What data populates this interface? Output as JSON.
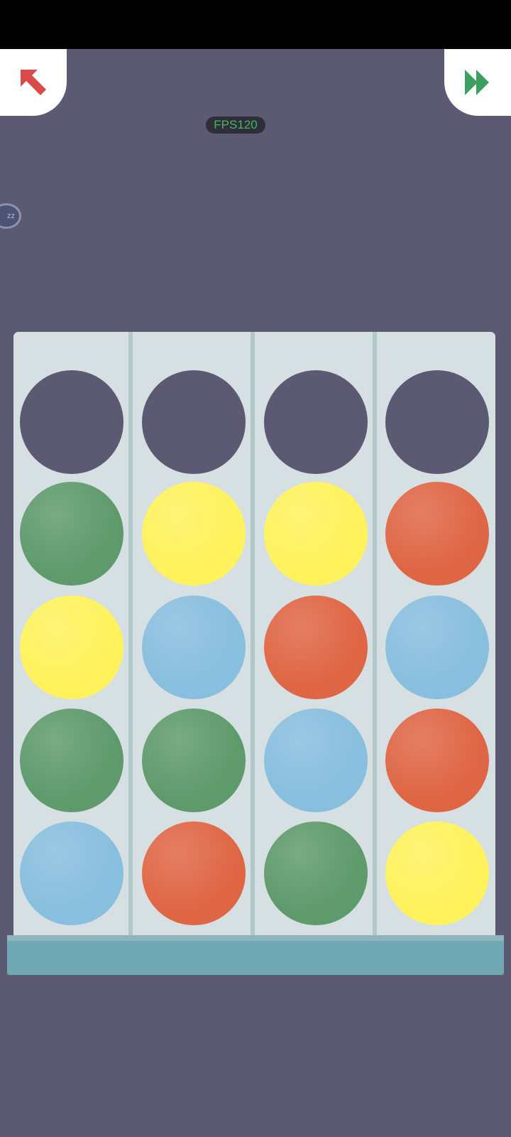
{
  "header": {
    "back_icon": "arrow-up-left-icon",
    "skip_icon": "fast-forward-icon",
    "fps_label": "FPS120",
    "bubble_label": "zz"
  },
  "colors": {
    "empty": "#5c5a72",
    "green": "#5f9a6c",
    "yellow": "#fff25c",
    "red": "#df6645",
    "blue": "#88bede",
    "back_arrow": "#d94a4a",
    "skip_arrow": "#3c9f5f"
  },
  "board": {
    "tubes": [
      [
        "empty",
        "green",
        "yellow",
        "green",
        "blue"
      ],
      [
        "empty",
        "yellow",
        "blue",
        "green",
        "red"
      ],
      [
        "empty",
        "yellow",
        "red",
        "blue",
        "green"
      ],
      [
        "empty",
        "red",
        "blue",
        "red",
        "yellow"
      ]
    ]
  }
}
